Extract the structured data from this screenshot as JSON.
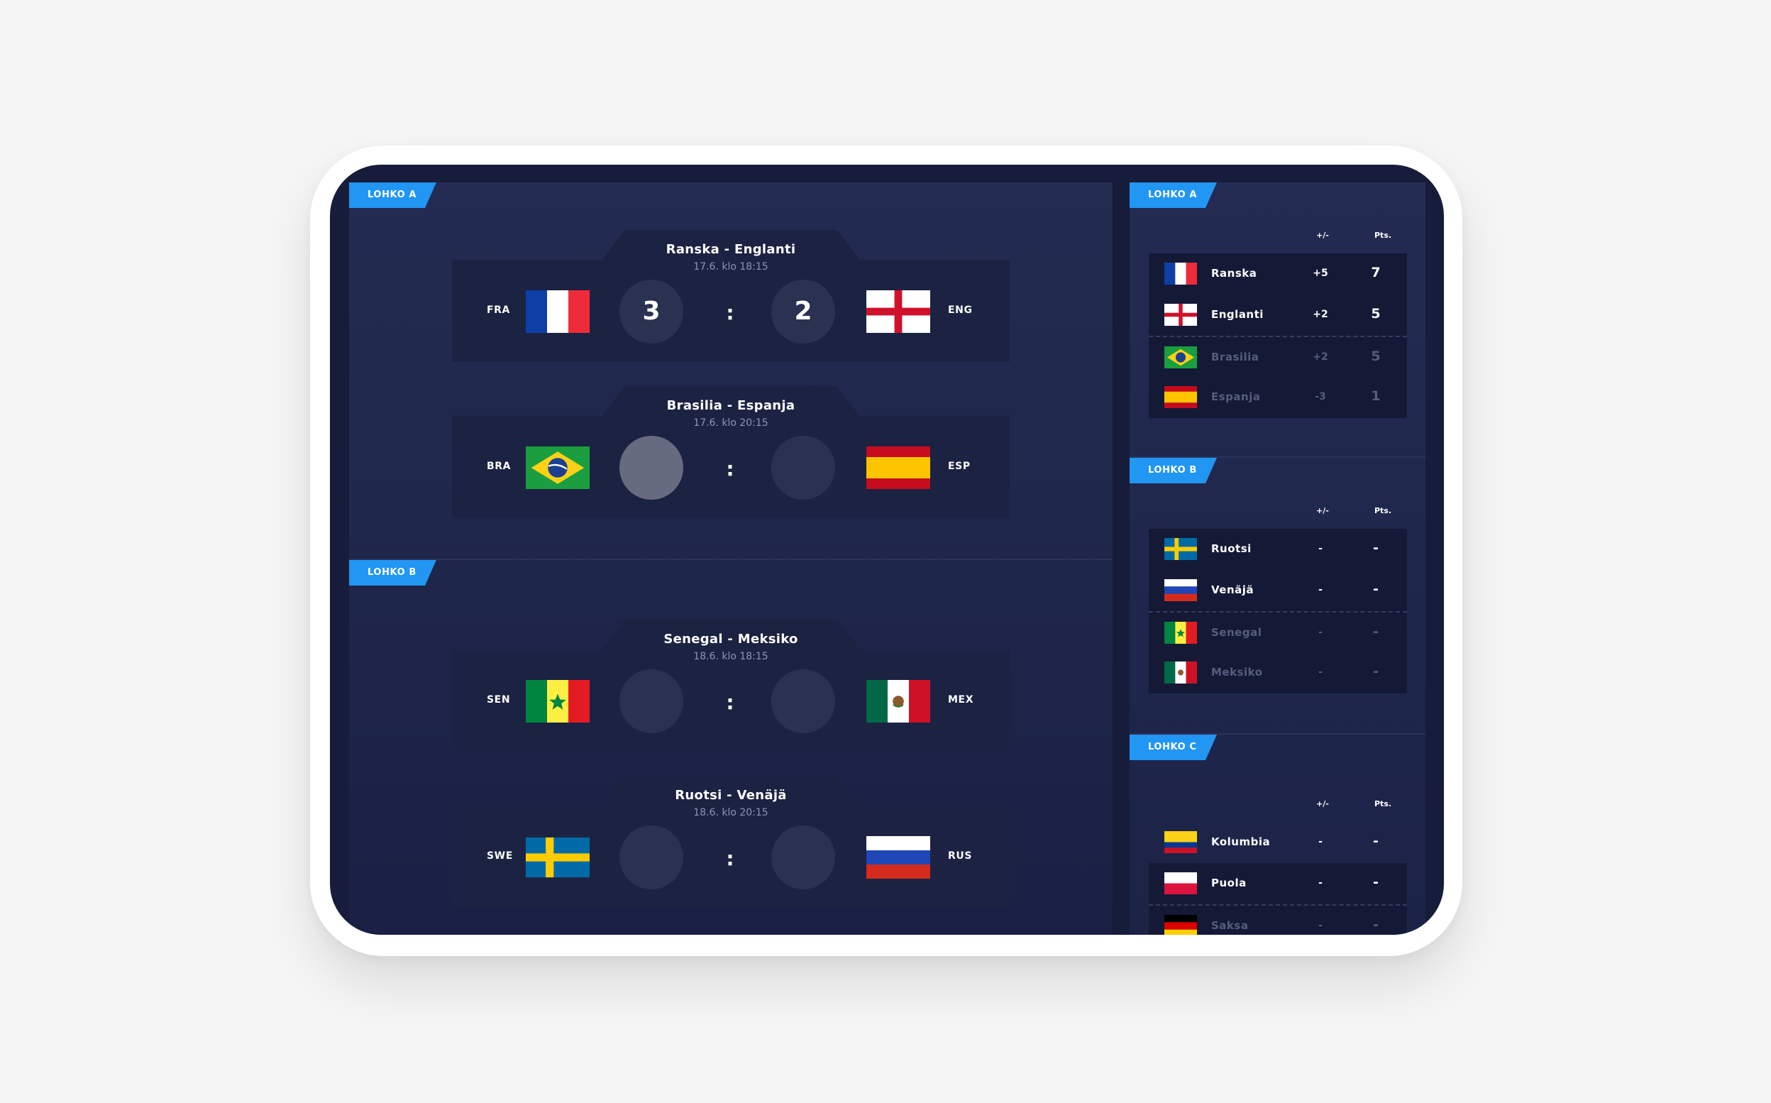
{
  "schedule": {
    "groups": [
      {
        "label": "LOHKO A",
        "matches": [
          {
            "title": "Ranska - Englanti",
            "time": "17.6. klo 18:15",
            "home_code": "FRA",
            "away_code": "ENG",
            "home_flag": "france-flag",
            "away_flag": "england-flag",
            "home_score": "3",
            "away_score": "2",
            "separator": ":"
          },
          {
            "title": "Brasilia - Espanja",
            "time": "17.6. klo 20:15",
            "home_code": "BRA",
            "away_code": "ESP",
            "home_flag": "brazil-flag",
            "away_flag": "spain-flag",
            "home_score": "",
            "away_score": "",
            "separator": ":"
          }
        ]
      },
      {
        "label": "LOHKO B",
        "matches": [
          {
            "title": "Senegal - Meksiko",
            "time": "18.6. klo 18:15",
            "home_code": "SEN",
            "away_code": "MEX",
            "home_flag": "senegal-flag",
            "away_flag": "mexico-flag",
            "home_score": "",
            "away_score": "",
            "separator": ":"
          },
          {
            "title": "Ruotsi - Venäjä",
            "time": "18.6. klo 20:15",
            "home_code": "SWE",
            "away_code": "RUS",
            "home_flag": "sweden-flag",
            "away_flag": "russia-flag",
            "home_score": "",
            "away_score": "",
            "separator": ":"
          }
        ]
      }
    ]
  },
  "standings": {
    "col_diff": "+/-",
    "col_pts": "Pts.",
    "groups": [
      {
        "label": "LOHKO A",
        "rows": [
          {
            "flag": "france-flag",
            "name": "Ranska",
            "diff": "+5",
            "pts": "7"
          },
          {
            "flag": "england-flag",
            "name": "Englanti",
            "diff": "+2",
            "pts": "5"
          },
          {
            "flag": "brazil-flag",
            "name": "Brasilia",
            "diff": "+2",
            "pts": "5"
          },
          {
            "flag": "spain-flag",
            "name": "Espanja",
            "diff": "-3",
            "pts": "1"
          }
        ]
      },
      {
        "label": "LOHKO B",
        "rows": [
          {
            "flag": "sweden-flag",
            "name": "Ruotsi",
            "diff": "-",
            "pts": "-"
          },
          {
            "flag": "russia-flag",
            "name": "Venäjä",
            "diff": "-",
            "pts": "-"
          },
          {
            "flag": "senegal-flag",
            "name": "Senegal",
            "diff": "-",
            "pts": "-"
          },
          {
            "flag": "mexico-flag",
            "name": "Meksiko",
            "diff": "-",
            "pts": "-"
          }
        ]
      },
      {
        "label": "LOHKO C",
        "rows": [
          {
            "flag": "colombia-flag",
            "name": "Kolumbia",
            "diff": "-",
            "pts": "-"
          },
          {
            "flag": "poland-flag",
            "name": "Puola",
            "diff": "-",
            "pts": "-"
          },
          {
            "flag": "germany-flag",
            "name": "Saksa",
            "diff": "-",
            "pts": "-"
          }
        ]
      }
    ]
  },
  "colors": {
    "tag": "#2196f3",
    "panel": "#232b52",
    "card": "#1c2242",
    "score_empty": "#2b3150",
    "score_active": "#666b7f",
    "dim_text": "#565c7e"
  }
}
